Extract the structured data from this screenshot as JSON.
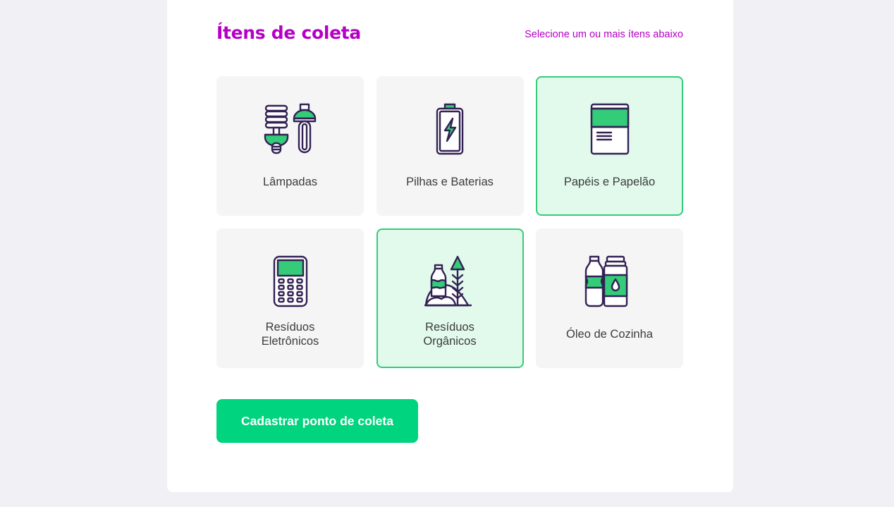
{
  "section": {
    "title": "Ítens de coleta",
    "hint": "Selecione um ou mais ítens abaixo"
  },
  "items": [
    {
      "label": "Lâmpadas",
      "icon": "lamps-icon",
      "selected": false
    },
    {
      "label": "Pilhas e Baterias",
      "icon": "battery-icon",
      "selected": false
    },
    {
      "label": "Papéis e Papelão",
      "icon": "paper-icon",
      "selected": true
    },
    {
      "label": "Resíduos\nEletrônicos",
      "icon": "electronics-icon",
      "selected": false
    },
    {
      "label": "Resíduos\nOrgânicos",
      "icon": "organic-waste-icon",
      "selected": true
    },
    {
      "label": "Óleo de Cozinha",
      "icon": "cooking-oil-icon",
      "selected": false
    }
  ],
  "submit_label": "Cadastrar ponto de coleta",
  "colors": {
    "title": "#B400C4",
    "accent": "#34CB79",
    "selected_bg": "#E1FAEC",
    "button": "#00D47E",
    "icon_stroke": "#322153"
  }
}
